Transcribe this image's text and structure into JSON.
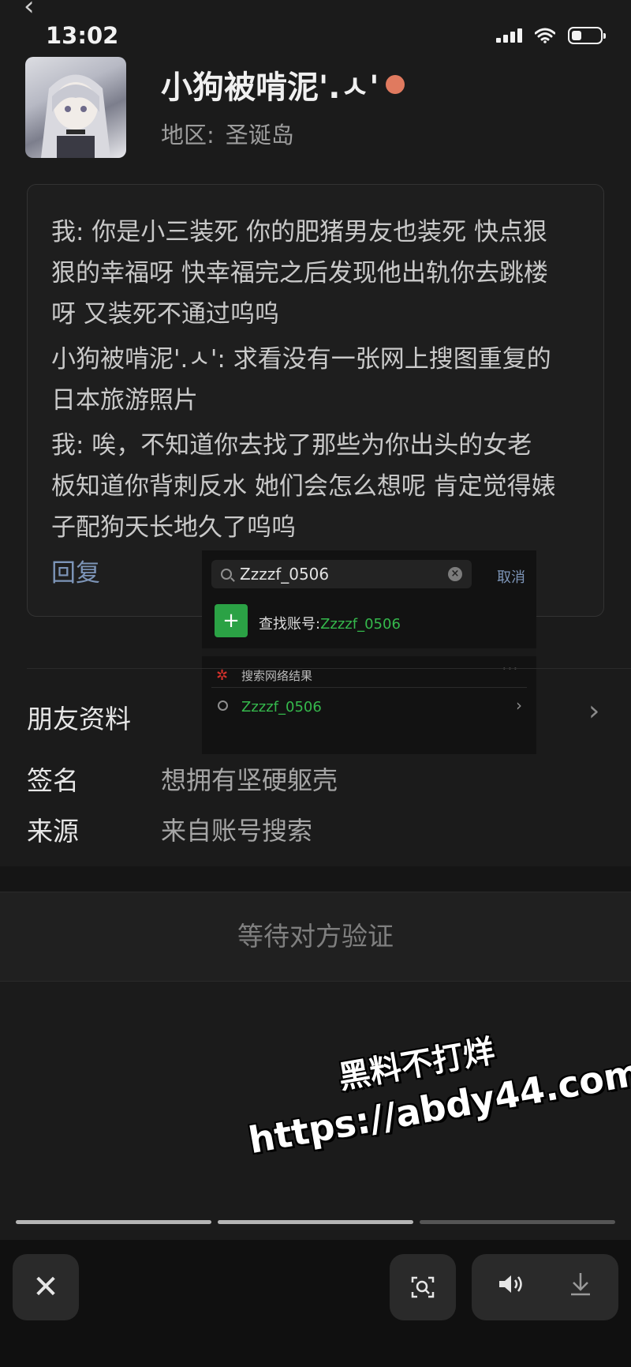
{
  "status_bar": {
    "time": "13:02",
    "icons": [
      "signal-icon",
      "wifi-icon",
      "battery-icon"
    ]
  },
  "nav": {
    "back_icon": "back-chevron-icon"
  },
  "profile": {
    "name": "小狗被啃泥'.ㅅ'",
    "region_label": "地区:",
    "region_value": "圣诞岛"
  },
  "verification_card": {
    "messages": [
      "我: 你是小三装死 你的肥猪男友也装死 快点狠狠的幸福呀 快幸福完之后发现他出轨你去跳楼呀 又装死不通过呜呜",
      "小狗被啃泥'.ㅅ': 求看没有一张网上搜图重复的日本旅游照片",
      "我: 唉，不知道你去找了那些为你出头的女老板知道你背刺反水 她们会怎么想呢 肯定觉得婊子配狗天长地久了呜呜"
    ],
    "reply_label": "回复"
  },
  "search_overlay": {
    "query": "Zzzzf_0506",
    "cancel_label": "取消",
    "find_account_label": "查找账号:",
    "find_account_value": "Zzzzf_0506",
    "web_results_label": "搜索网络结果",
    "web_result_item": "Zzzzf_0506"
  },
  "friend_info": {
    "section_label": "朋友资料",
    "signature_label": "签名",
    "signature_value": "想拥有坚硬躯壳",
    "source_label": "来源",
    "source_value": "来自账号搜索"
  },
  "action": {
    "wait_label": "等待对方验证"
  },
  "watermark": {
    "line1": "黑料不打烊",
    "line2": "https://abdy44.com"
  },
  "story_progress": [
    {
      "state": "viewed",
      "color": "#b5b5b5"
    },
    {
      "state": "current",
      "color": "#b5b5b5"
    },
    {
      "state": "upcoming",
      "color": "#555555"
    }
  ],
  "bottom_controls": [
    "close-icon",
    "scan-image-icon",
    "volume-icon",
    "download-icon"
  ]
}
